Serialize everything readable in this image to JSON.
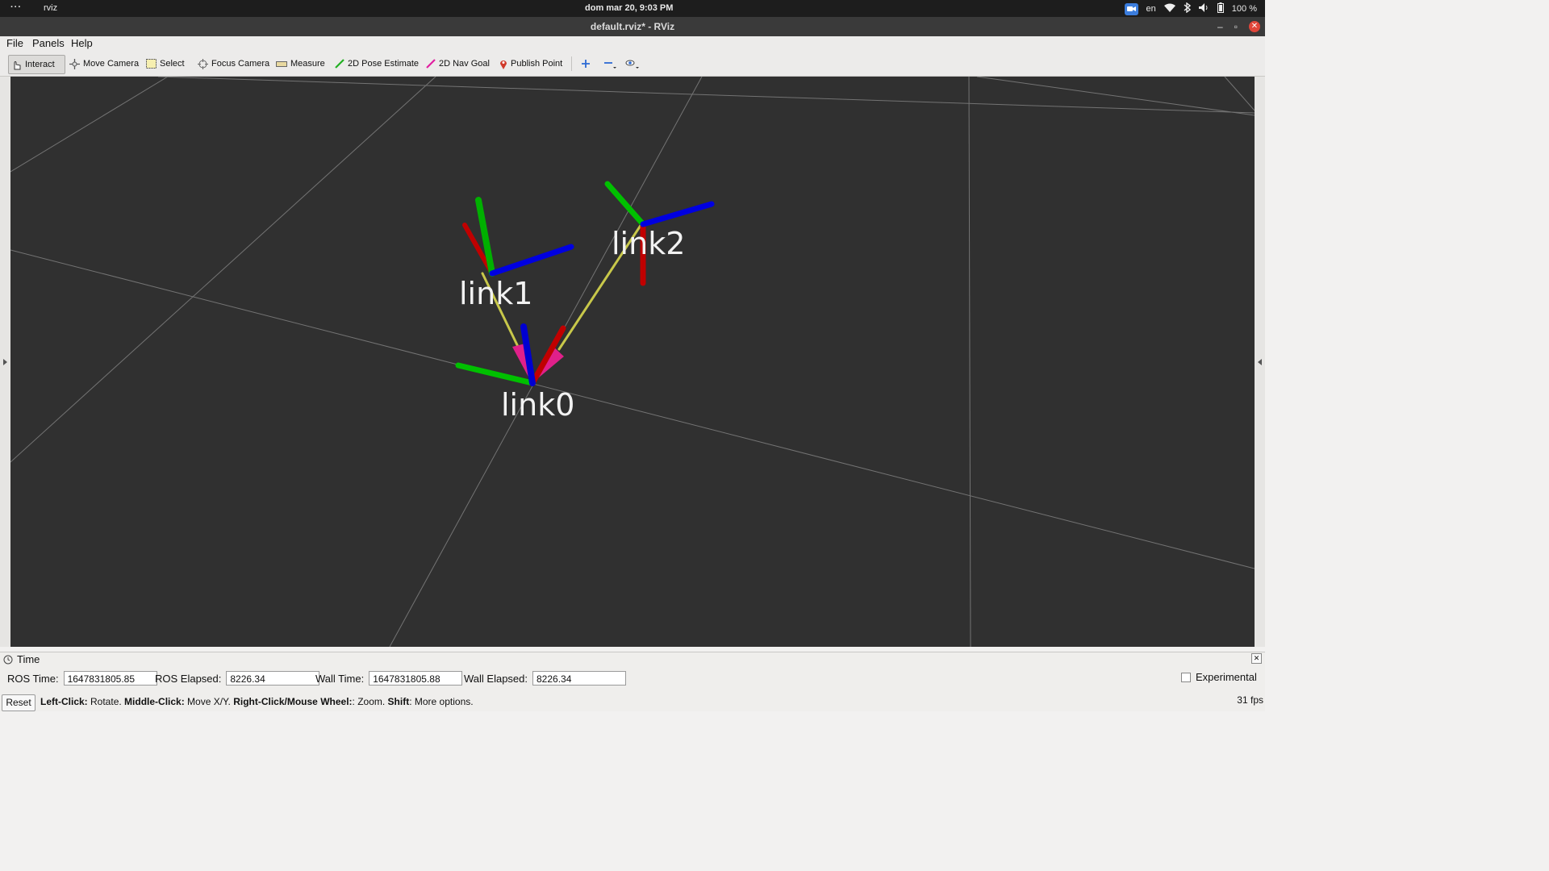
{
  "system_bar": {
    "dots": "···",
    "app_name": "rviz",
    "clock": "dom mar 20,  9:03 PM",
    "lang": "en",
    "battery": "100 %"
  },
  "window": {
    "title": "default.rviz* - RViz"
  },
  "menu": {
    "file": "File",
    "panels": "Panels",
    "help": "Help"
  },
  "toolbar": {
    "interact": "Interact",
    "move_camera": "Move Camera",
    "select": "Select",
    "focus_camera": "Focus Camera",
    "measure": "Measure",
    "pose_estimate": "2D Pose Estimate",
    "nav_goal": "2D Nav Goal",
    "publish_point": "Publish Point"
  },
  "scene": {
    "frames": [
      {
        "label": "link0"
      },
      {
        "label": "link1"
      },
      {
        "label": "link2"
      }
    ],
    "colors": {
      "background": "#303030",
      "grid": "#a0a0a0",
      "x_axis": "#d00000",
      "y_axis": "#00c000",
      "z_axis": "#0000e0",
      "tf_link": "#c8c84a",
      "tf_arrow": "#e0208a"
    }
  },
  "time_panel": {
    "title": "Time",
    "ros_time_label": "ROS Time:",
    "ros_time": "1647831805.85",
    "ros_elapsed_label": "ROS Elapsed:",
    "ros_elapsed": "8226.34",
    "wall_time_label": "Wall Time:",
    "wall_time": "1647831805.88",
    "wall_elapsed_label": "Wall Elapsed:",
    "wall_elapsed": "8226.34",
    "experimental": "Experimental"
  },
  "status": {
    "reset": "Reset",
    "hint_parts": [
      {
        "bold": "Left-Click:",
        "text": " Rotate. "
      },
      {
        "bold": "Middle-Click:",
        "text": " Move X/Y. "
      },
      {
        "bold": "Right-Click/Mouse Wheel:",
        "text": ": Zoom. "
      },
      {
        "bold": "Shift",
        "text": ": More options."
      }
    ],
    "fps": "31 fps"
  }
}
